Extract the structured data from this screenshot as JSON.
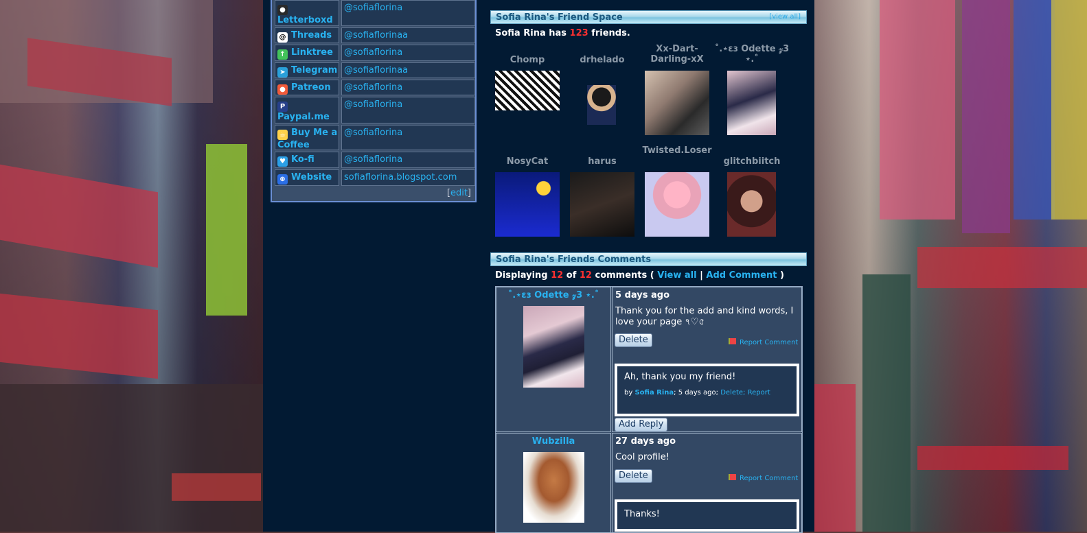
{
  "contact": {
    "rows": [
      {
        "label": "Letterboxd",
        "value": "@sofiaflorina",
        "icon": "letterboxd-icon"
      },
      {
        "label": "Threads",
        "value": "@sofiaflorinaa",
        "icon": "threads-icon"
      },
      {
        "label": "Linktree",
        "value": "@sofiaflorina",
        "icon": "linktree-icon"
      },
      {
        "label": "Telegram",
        "value": "@sofiaflorinaa",
        "icon": "telegram-icon"
      },
      {
        "label": "Patreon",
        "value": "@sofiaflorina",
        "icon": "patreon-icon"
      },
      {
        "label": "Paypal.me",
        "value": "@sofiaflorina",
        "icon": "paypal-icon"
      },
      {
        "label": "Buy Me a Coffee",
        "value": "@sofiaflorina",
        "icon": "coffee-icon"
      },
      {
        "label": "Ko-fi",
        "value": "@sofiaflorina",
        "icon": "kofi-icon"
      },
      {
        "label": "Website",
        "value": "sofiaflorina.blogspot.com",
        "icon": "globe-icon"
      }
    ],
    "edit_open": "[",
    "edit_label": "edit",
    "edit_close": "]"
  },
  "friend_space": {
    "title": "Sofia Rina's Friend Space",
    "view_all": "[view all]",
    "count_prefix": "Sofia Rina has ",
    "count": "123",
    "count_suffix": " friends.",
    "friends": [
      {
        "name": "Chomp"
      },
      {
        "name": "drhelado"
      },
      {
        "name": "Xx-Dart-Darling-xX"
      },
      {
        "name": "˚.⋆ɛɜ Odette 𝓏3 ⋆.˚"
      },
      {
        "name": "NosyCat"
      },
      {
        "name": "harus"
      },
      {
        "name": "Twisted.Loser"
      },
      {
        "name": "glitchbiitch"
      }
    ]
  },
  "comments": {
    "title": "Sofia Rina's Friends Comments",
    "displaying_label": "Displaying ",
    "shown": "12",
    "of_label": " of ",
    "total": "12",
    "comments_label": " comments ( ",
    "view_all": "View all",
    "separator": " | ",
    "add_comment": "Add Comment",
    "close_paren": " )",
    "items": [
      {
        "author": "˚.⋆ɛɜ Odette 𝓏3 ⋆.˚",
        "time": "5 days ago",
        "text": "Thank you for the add and kind words, I love your page ৭♡৫",
        "delete": "Delete",
        "report": "Report Comment",
        "reply_text": "Ah, thank you my friend!",
        "reply_by": "by ",
        "reply_author": "Sofia Rina",
        "reply_time": "; 5 days ago; ",
        "reply_delete": "Delete",
        "reply_sep": "; ",
        "reply_report": "Report",
        "add_reply": "Add Reply"
      },
      {
        "author": "Wubzilla",
        "time": "27 days ago",
        "text": "Cool profile!",
        "delete": "Delete",
        "report": "Report Comment",
        "reply_text": "Thanks!"
      }
    ]
  }
}
